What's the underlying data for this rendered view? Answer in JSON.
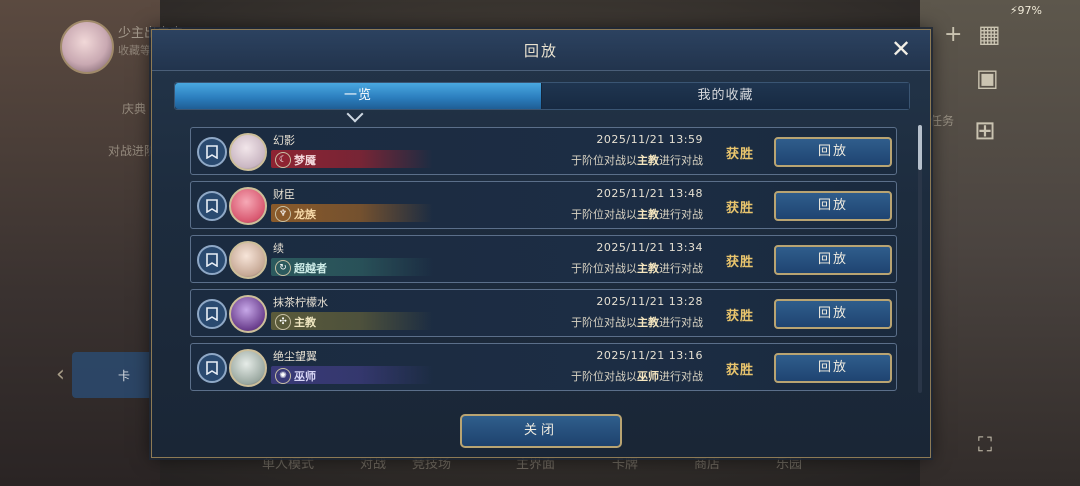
{
  "background": {
    "player_name": "少主出击中",
    "player_sub": "收藏等",
    "menu_items": [
      "庆典",
      "对战进阶"
    ],
    "left_tab_label": "卡",
    "status": "97%",
    "bottom_nav": [
      "单人模式",
      "对战",
      "竞技场",
      "主界面",
      "卡牌",
      "商店",
      "乐园"
    ],
    "right_label": "任务"
  },
  "dialog": {
    "title": "回放",
    "tabs": [
      {
        "label": "一览",
        "active": true
      },
      {
        "label": "我的收藏",
        "active": false
      }
    ],
    "close_label": "关闭",
    "replay_label": "回放"
  },
  "replays": [
    {
      "player": "幻影",
      "class": "梦魇",
      "class_icon": "☾",
      "class_color": "#8e2332",
      "class_text_color": "#f3d8dc",
      "datetime": "2025/11/21  13:59",
      "desc_pre": "于阶位对战以",
      "desc_class": "主教",
      "desc_post": "进行对战",
      "result": "获胜",
      "avatar_colors": [
        "#f2e6ea",
        "#c9b6c2"
      ]
    },
    {
      "player": "财臣",
      "class": "龙族",
      "class_icon": "♆",
      "class_color": "#8a5a2a",
      "class_text_color": "#f6d9a8",
      "datetime": "2025/11/21  13:48",
      "desc_pre": "于阶位对战以",
      "desc_class": "主教",
      "desc_post": "进行对战",
      "result": "获胜",
      "avatar_colors": [
        "#f6a9b6",
        "#d8576f"
      ]
    },
    {
      "player": "续",
      "class": "超越者",
      "class_icon": "↻",
      "class_color": "#2c5a5e",
      "class_text_color": "#cfeee9",
      "datetime": "2025/11/21  13:34",
      "desc_pre": "于阶位对战以",
      "desc_class": "主教",
      "desc_post": "进行对战",
      "result": "获胜",
      "avatar_colors": [
        "#f7e5d9",
        "#c6a895"
      ]
    },
    {
      "player": "抹茶柠檬水",
      "class": "主教",
      "class_icon": "✣",
      "class_color": "#5a5a3a",
      "class_text_color": "#efe6c0",
      "datetime": "2025/11/21  13:28",
      "desc_pre": "于阶位对战以",
      "desc_class": "主教",
      "desc_post": "进行对战",
      "result": "获胜",
      "avatar_colors": [
        "#c7a8e8",
        "#6b3f8e"
      ]
    },
    {
      "player": "绝尘望翼",
      "class": "巫师",
      "class_icon": "✺",
      "class_color": "#3a3a78",
      "class_text_color": "#d8d6f6",
      "datetime": "2025/11/21  13:16",
      "desc_pre": "于阶位对战以",
      "desc_class": "巫师",
      "desc_post": "进行对战",
      "result": "获胜",
      "avatar_colors": [
        "#e6ece8",
        "#9aa8a0"
      ]
    }
  ]
}
